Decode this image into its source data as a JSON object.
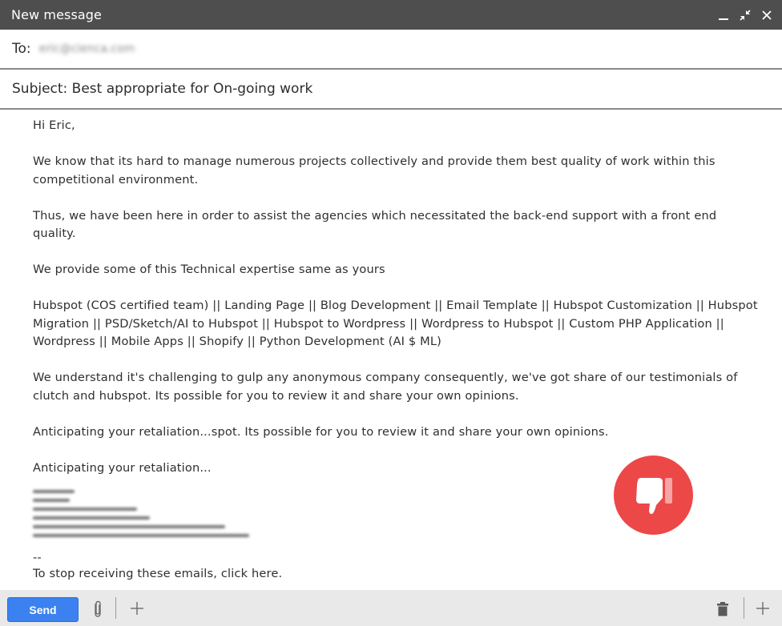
{
  "window": {
    "title": "New message",
    "controls": [
      {
        "name": "minimize",
        "icon": "minimize-icon"
      },
      {
        "name": "collapse",
        "icon": "collapse-arrows-icon"
      },
      {
        "name": "close",
        "icon": "close-icon"
      }
    ]
  },
  "to": {
    "label": "To:",
    "value_redacted": "eric@cienca.com"
  },
  "subject": {
    "label": "Subject:",
    "value": "Best appropriate for On-going work",
    "full": "Subject: Best appropriate for On-going work"
  },
  "body": {
    "greeting": "Hi Eric,",
    "paragraphs": [
      "We know that its hard to manage numerous projects collectively and provide them best quality of work within this competitional environment.",
      "Thus, we have been here in order to assist the agencies which necessitated the back-end support with a front end quality.",
      "We provide some of this Technical expertise same as yours",
      "Hubspot (COS certified team) || Landing Page || Blog Development || Email Template || Hubspot Customization || Hubspot Migration || PSD/Sketch/AI to Hubspot || Hubspot to Wordpress || Wordpress to Hubspot || Custom PHP Application || Wordpress || Mobile Apps || Shopify || Python Development (AI $ ML)",
      "We understand it's challenging to gulp any anonymous company consequently, we've got share of our testimonials of clutch and hubspot. Its possible for you to review it and share your own opinions.",
      "Anticipating your retaliation...spot. Its possible for you to review it and share your own opinions.",
      "Anticipating your retaliation..."
    ],
    "signature_redacted": true,
    "separator": "--",
    "unsubscribe": "To stop receiving these emails, click here."
  },
  "badge": {
    "icon": "thumbs-down-icon",
    "color": "#ec4848"
  },
  "toolbar": {
    "send_label": "Send",
    "send_color": "#3b82f0",
    "attach_icon": "paperclip-icon",
    "add_icon": "plus-icon",
    "delete_icon": "trash-icon",
    "more_icon": "plus-icon"
  }
}
